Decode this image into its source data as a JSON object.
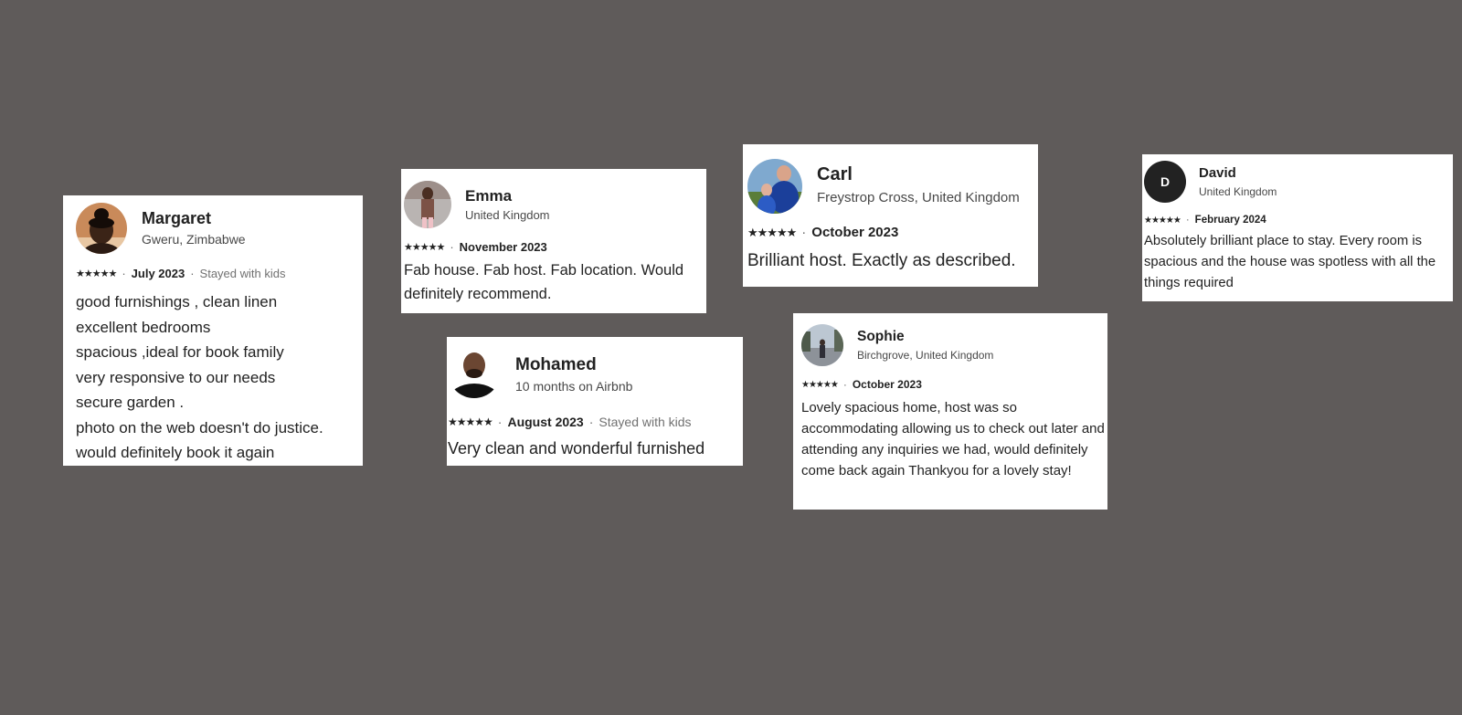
{
  "reviews": [
    {
      "name": "Margaret",
      "location": "Gweru, Zimbabwe",
      "stars": "★★★★★",
      "date": "July 2023",
      "note": "Stayed with kids",
      "lines": [
        "good furnishings , clean linen",
        "excellent bedrooms",
        "spacious ,ideal for book family",
        "very responsive to our needs",
        "secure garden .",
        "photo on the web doesn't do justice.",
        "would definitely book it again"
      ]
    },
    {
      "name": "Emma",
      "location": "United Kingdom",
      "stars": "★★★★★",
      "date": "November 2023",
      "text": "Fab house. Fab host. Fab location. Would definitely recommend."
    },
    {
      "name": "Mohamed",
      "location": "10 months on Airbnb",
      "stars": "★★★★★",
      "date": "August 2023",
      "note": "Stayed with kids",
      "text": "Very clean and wonderful furnished"
    },
    {
      "name": "Carl",
      "location": "Freystrop Cross, United Kingdom",
      "stars": "★★★★★",
      "date": "October 2023",
      "text": "Brilliant host. Exactly as described."
    },
    {
      "name": "Sophie",
      "location": "Birchgrove, United Kingdom",
      "stars": "★★★★★",
      "date": "October 2023",
      "text": "Lovely spacious home, host was so accommodating allowing us to check out later and attending any inquiries we had, would definitely come back again Thankyou for a lovely stay!"
    },
    {
      "name": "David",
      "initial": "D",
      "location": "United Kingdom",
      "stars": "★★★★★",
      "date": "February 2024",
      "text": "Absolutely brilliant place to stay. Every room is spacious and the house was spotless with all the things required"
    }
  ],
  "separator": "·"
}
